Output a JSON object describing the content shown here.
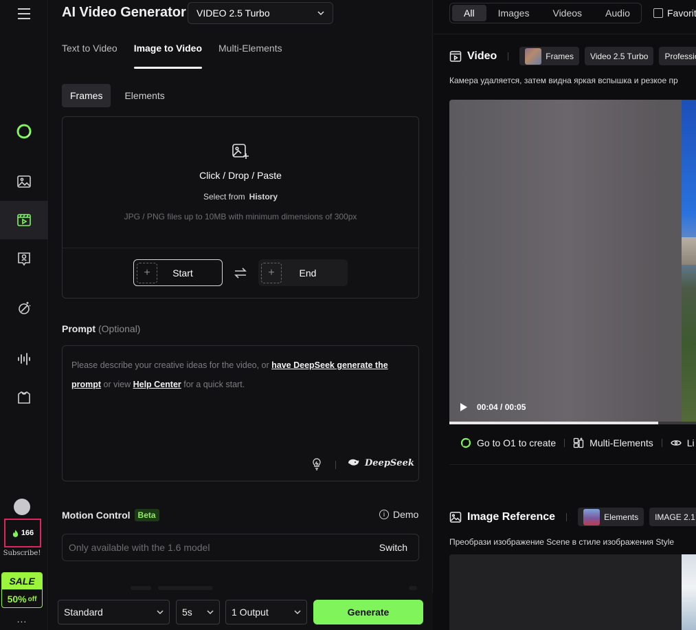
{
  "app": {
    "title": "AI Video Generator",
    "model": "VIDEO 2.5 Turbo"
  },
  "tabs": [
    {
      "label": "Text to Video",
      "active": false
    },
    {
      "label": "Image to Video",
      "active": true
    },
    {
      "label": "Multi-Elements",
      "active": false
    }
  ],
  "subtabs": [
    {
      "label": "Frames",
      "active": true
    },
    {
      "label": "Elements",
      "active": false
    }
  ],
  "upload": {
    "main": "Click / Drop / Paste",
    "select_from": "Select from",
    "history": "History",
    "hint": "JPG / PNG files up to 10MB with minimum dimensions of 300px",
    "start_label": "Start",
    "end_label": "End"
  },
  "prompt": {
    "label": "Prompt",
    "optional": "(Optional)",
    "text_1": "Please describe your creative ideas for the video, or ",
    "link_deepseek": "have DeepSeek generate the prompt",
    "text_2": " or view ",
    "link_help": "Help Center",
    "text_3": " for a quick start.",
    "brand": "DeepSeek"
  },
  "motion": {
    "label": "Motion Control",
    "badge": "Beta",
    "demo": "Demo",
    "placeholder": "Only available with the 1.6 model",
    "switch": "Switch"
  },
  "bottom": {
    "quality": "Standard",
    "duration": "5s",
    "outputs": "1 Output",
    "generate": "Generate"
  },
  "rail": {
    "credits": "166",
    "subscribe": "Subscribe!",
    "sale": "SALE",
    "discount": "50%",
    "off": "off",
    "more": "..."
  },
  "right": {
    "filters": [
      {
        "label": "All",
        "active": true
      },
      {
        "label": "Images",
        "active": false
      },
      {
        "label": "Videos",
        "active": false
      },
      {
        "label": "Audio",
        "active": false
      }
    ],
    "favorites": "Favorit",
    "video_card": {
      "title": "Video",
      "chips": [
        "Frames",
        "Video 2.5 Turbo",
        "Profession"
      ],
      "desc": "Камера удаляется, затем видна яркая вспышка и резкое пр",
      "time": "00:04 / 00:05",
      "progress": 0.8,
      "actions": [
        "Go to O1 to create",
        "Multi-Elements",
        "Li"
      ]
    },
    "image_card": {
      "title": "Image Reference",
      "chips": [
        "Elements",
        "IMAGE 2.1"
      ],
      "desc": "Преобрази изображение Scene в стиле изображения Style"
    }
  },
  "colors": {
    "accent": "#7ff55b",
    "highlight": "#e0245e"
  }
}
